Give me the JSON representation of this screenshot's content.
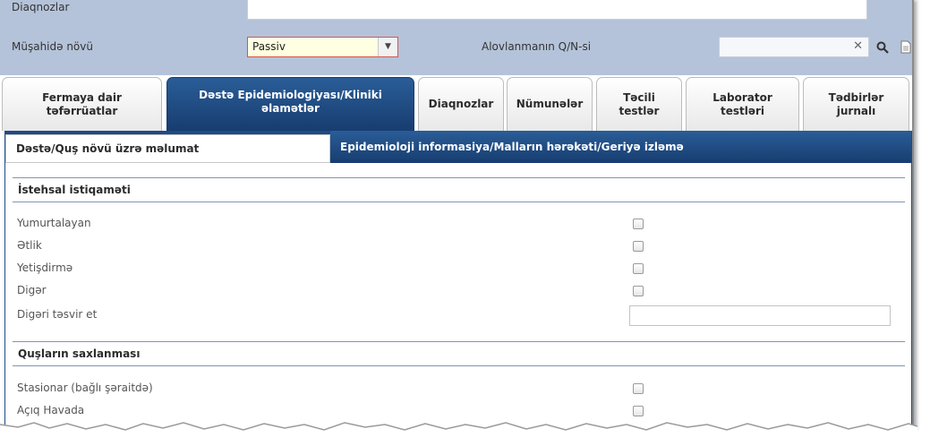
{
  "filters": {
    "diagnoses_label": "Diaqnozlar",
    "diagnoses_value": "",
    "observation_type_label": "Müşahidə növü",
    "observation_type_value": "Passiv",
    "outbreak_label": "Alovlanmanın Q/N-si",
    "outbreak_value": ""
  },
  "tabs": [
    {
      "label": "Fermaya dair\ntəfərrüatlar",
      "active": false
    },
    {
      "label": "Dəstə Epidemiologiyası/Kliniki\nəlamətlər",
      "active": true
    },
    {
      "label": "Diaqnozlar",
      "active": false
    },
    {
      "label": "Nümunələr",
      "active": false
    },
    {
      "label": "Təcili\ntestlər",
      "active": false
    },
    {
      "label": "Laborator\ntestləri",
      "active": false
    },
    {
      "label": "Tədbirlər\njurnalı",
      "active": false
    }
  ],
  "subtabs": {
    "inactive": "Dəstə/Quş növü üzrə məlumat",
    "active": "Epidemioloji informasiya/Malların hərəkəti/Geriyə izləmə"
  },
  "production": {
    "title": "İstehsal istiqaməti",
    "items": [
      "Yumurtalayan",
      "Ətlik",
      "Yetişdirmə",
      "Digər"
    ],
    "other_describe_label": "Digəri təsvir et",
    "other_describe_value": ""
  },
  "housing": {
    "title": "Quşların saxlanması",
    "items": [
      "Stasionar (bağlı şəraitdə)",
      "Açıq Havada"
    ]
  },
  "colors": {
    "header_bg": "#b4c3d9",
    "accent_blue": "#1f4a85",
    "select_bg": "#ffffe1",
    "select_border": "#d9534f"
  }
}
